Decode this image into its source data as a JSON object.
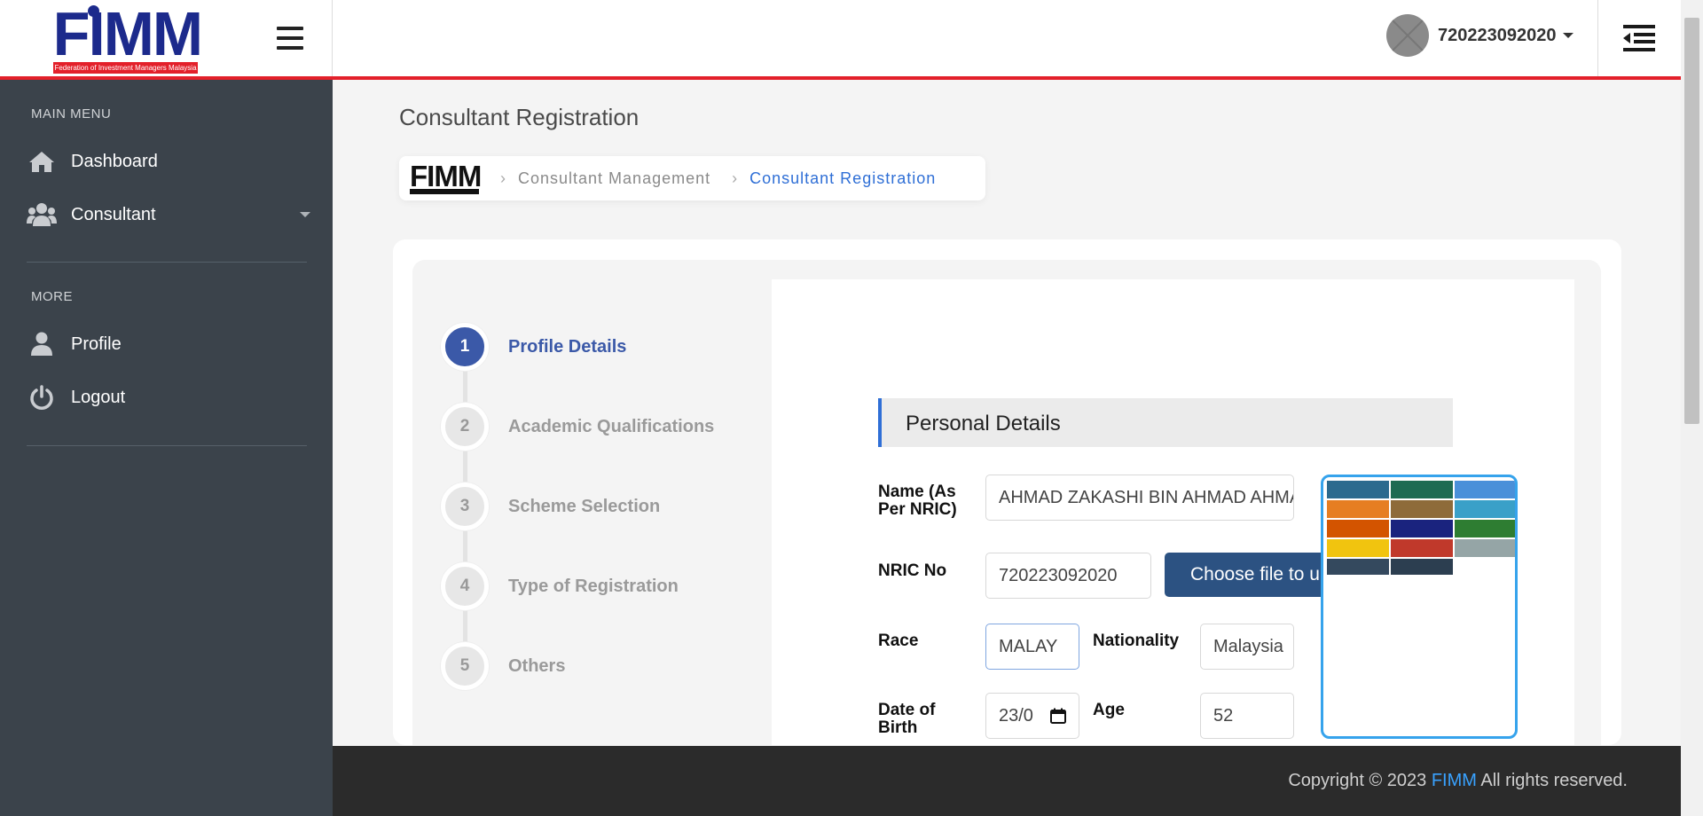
{
  "header": {
    "logo_text": "FIMM",
    "logo_subtitle": "Federation of Investment Managers Malaysia",
    "username": "720223092020"
  },
  "sidebar": {
    "main_menu_title": "MAIN MENU",
    "more_title": "MORE",
    "items": [
      {
        "label": "Dashboard",
        "icon": "home-icon"
      },
      {
        "label": "Consultant",
        "icon": "users-icon"
      },
      {
        "label": "Profile",
        "icon": "user-icon"
      },
      {
        "label": "Logout",
        "icon": "power-icon"
      }
    ]
  },
  "page": {
    "title": "Consultant Registration",
    "breadcrumb": [
      "Consultant Management",
      "Consultant Registration"
    ],
    "breadcrumb_logo": "FIMM"
  },
  "steps": [
    {
      "num": "1",
      "label": "Profile Details",
      "active": true
    },
    {
      "num": "2",
      "label": "Academic Qualifications"
    },
    {
      "num": "3",
      "label": "Scheme Selection"
    },
    {
      "num": "4",
      "label": "Type of Registration"
    },
    {
      "num": "5",
      "label": "Others"
    }
  ],
  "form": {
    "section_title": "Personal Details",
    "name_label": "Name (As Per NRIC)",
    "name_value": "AHMAD ZAKASHI BIN AHMAD AHMAD",
    "nric_label": "NRIC No",
    "nric_value": "720223092020",
    "file_button": "Choose file to upload",
    "race_label": "Race",
    "race_value": "MALAY",
    "nationality_label": "Nationality",
    "nationality_value": "Malaysia",
    "dob_label": "Date of Birth",
    "dob_value": "23/0",
    "age_label": "Age",
    "age_value": "52"
  },
  "footer": {
    "prefix": "Copyright © 2023 ",
    "brand": "FIMM",
    "suffix": " All rights reserved."
  },
  "colors": {
    "accent": "#3b59a8",
    "header_border": "#e3202a",
    "sidebar_bg": "#3b434b",
    "link": "#2f6fd6",
    "preview_border": "#36a3ec"
  }
}
